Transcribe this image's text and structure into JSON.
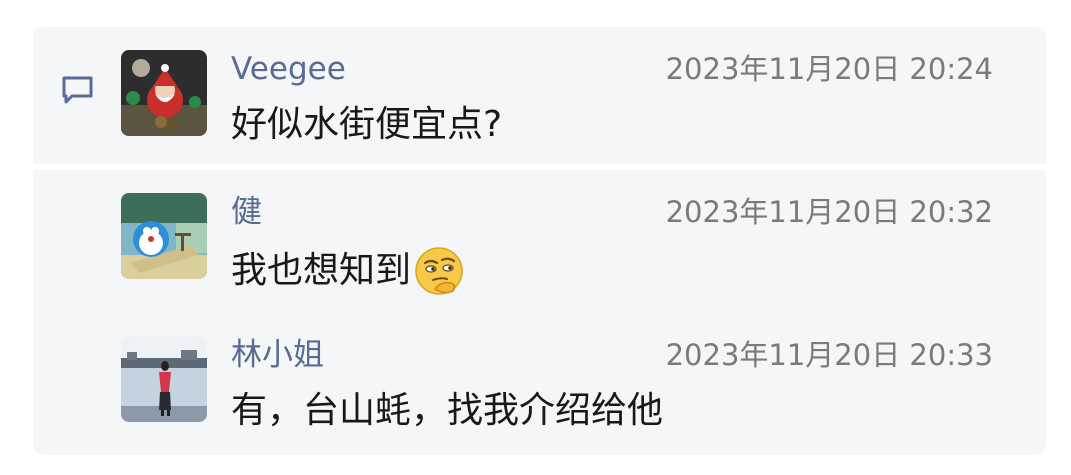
{
  "comment_icon": "comment-icon",
  "messages": [
    {
      "author": "Veegee",
      "time": "2023年11月20日 20:24",
      "text": "好似水街便宜点?",
      "avatar": "santa-avatar"
    },
    {
      "author": "健",
      "time": "2023年11月20日 20:32",
      "text": "我也想知到",
      "emoji": "thinking-face-emoji",
      "avatar": "doraemon-avatar"
    },
    {
      "author": "林小姐",
      "time": "2023年11月20日 20:33",
      "text": "有，台山蚝，找我介绍给他",
      "avatar": "lakeside-photo-avatar"
    }
  ],
  "colors": {
    "name": "#576b95",
    "time": "#7a7a7a",
    "text": "#181818",
    "panel": "#f5f6f7"
  }
}
